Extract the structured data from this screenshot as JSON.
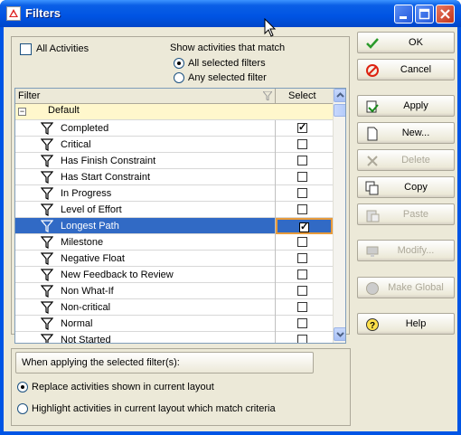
{
  "window": {
    "title": "Filters"
  },
  "options": {
    "all_activities_label": "All Activities",
    "match_header": "Show activities that match",
    "match_all": "All selected filters",
    "match_any": "Any selected filter"
  },
  "grid": {
    "col_filter": "Filter",
    "col_select": "Select",
    "group_name": "Default",
    "rows": [
      {
        "name": "Completed",
        "checked": true
      },
      {
        "name": "Critical",
        "checked": false
      },
      {
        "name": "Has Finish Constraint",
        "checked": false
      },
      {
        "name": "Has Start Constraint",
        "checked": false
      },
      {
        "name": "In Progress",
        "checked": false
      },
      {
        "name": "Level of Effort",
        "checked": false
      },
      {
        "name": "Longest Path",
        "checked": true
      },
      {
        "name": "Milestone",
        "checked": false
      },
      {
        "name": "Negative Float",
        "checked": false
      },
      {
        "name": "New Feedback to Review",
        "checked": false
      },
      {
        "name": "Non What-If",
        "checked": false
      },
      {
        "name": "Non-critical",
        "checked": false
      },
      {
        "name": "Normal",
        "checked": false
      },
      {
        "name": "Not Started",
        "checked": false
      }
    ]
  },
  "buttons": {
    "ok": "OK",
    "cancel": "Cancel",
    "apply": "Apply",
    "new": "New...",
    "delete": "Delete",
    "copy": "Copy",
    "paste": "Paste",
    "modify": "Modify...",
    "make_global": "Make Global",
    "help": "Help"
  },
  "apply_section": {
    "header": "When applying the selected filter(s):",
    "replace": "Replace activities shown in current layout",
    "highlight": "Highlight activities in current layout which match criteria"
  }
}
